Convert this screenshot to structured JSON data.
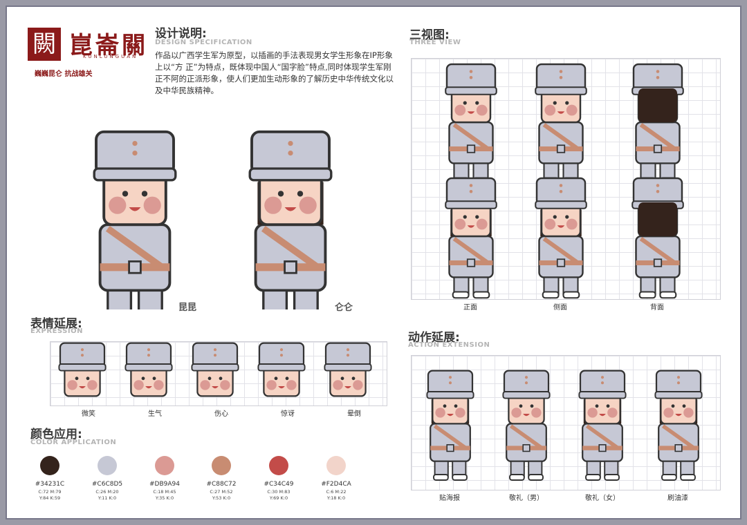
{
  "logo": {
    "glyph": "闕",
    "title": "崑崙關",
    "subtitle": "KUNLUNGUAN",
    "slogan": "巍巍昆仑  抗战雄关"
  },
  "design": {
    "title": "设计说明:",
    "subtitle": "DESIGN SPECIFICATION",
    "text": "作品以广西学生军为原型，以插画的手法表现男女学生形象在IP形象上以“方 正”为特点，既体现中国人“国字脸”特点,同时体现学生军刚正不阿的正派形象，使人们更加生动形象的了解历史中华传统文化以及中华民族精神。"
  },
  "characters": {
    "male": "昆昆",
    "female": "仑仑"
  },
  "three_view": {
    "title": "三视图:",
    "subtitle": "THREE VIEW",
    "labels": [
      "正面",
      "侧面",
      "背面"
    ]
  },
  "expression": {
    "title": "表情延展:",
    "subtitle": "EXPRESSION",
    "labels": [
      "微笑",
      "生气",
      "伤心",
      "惊讶",
      "晕倒"
    ]
  },
  "action": {
    "title": "动作延展:",
    "subtitle": "ACTION EXTENSION",
    "labels": [
      "贴海报",
      "敬礼（男）",
      "敬礼（女）",
      "刷油漆"
    ]
  },
  "color": {
    "title": "颜色应用:",
    "subtitle": "COLOR APPLICATION",
    "swatches": [
      {
        "hex": "#34231C",
        "c1": "C:72 M:79",
        "c2": "Y:84 K:59"
      },
      {
        "hex": "#C6C8D5",
        "c1": "C:26 M:20",
        "c2": "Y:11 K:0"
      },
      {
        "hex": "#DB9A94",
        "c1": "C:18 M:45",
        "c2": "Y:35 K:0"
      },
      {
        "hex": "#C88C72",
        "c1": "C:27 M:52",
        "c2": "Y:53 K:0"
      },
      {
        "hex": "#C34C49",
        "c1": "C:30 M:83",
        "c2": "Y:69 K:0"
      },
      {
        "hex": "#F2D4CA",
        "c1": "C:6 M:22",
        "c2": "Y:18 K:0"
      }
    ]
  }
}
